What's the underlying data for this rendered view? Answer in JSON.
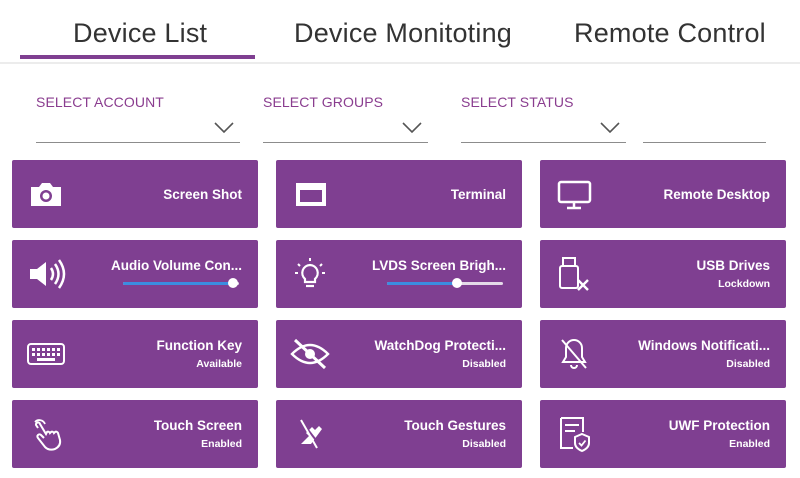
{
  "tabs": [
    {
      "label": "Device List",
      "active": true
    },
    {
      "label": "Device Monitoting",
      "active": false
    },
    {
      "label": "Remote Control",
      "active": false
    }
  ],
  "filters": {
    "account": {
      "label": "SELECT ACCOUNT",
      "value": ""
    },
    "groups": {
      "label": "SELECT GROUPS",
      "value": ""
    },
    "status": {
      "label": "SELECT STATUS",
      "value": ""
    },
    "search": {
      "value": ""
    }
  },
  "colors": {
    "accent": "#7f3f91",
    "label": "#8a3d8f",
    "slider_fill": "#3b8de0"
  },
  "tiles": [
    {
      "title": "Screen Shot",
      "subtitle": "",
      "icon": "camera-icon"
    },
    {
      "title": "Terminal",
      "subtitle": "",
      "icon": "terminal-window-icon"
    },
    {
      "title": "Remote Desktop",
      "subtitle": "",
      "icon": "monitor-icon"
    },
    {
      "title": "Audio Volume Con...",
      "subtitle": "",
      "icon": "speaker-icon",
      "level": 0.95
    },
    {
      "title": "LVDS Screen Brigh...",
      "subtitle": "",
      "icon": "lightbulb-icon",
      "level": 0.6
    },
    {
      "title": "USB Drives",
      "subtitle": "Lockdown",
      "icon": "usb-drive-blocked-icon"
    },
    {
      "title": "Function Key",
      "subtitle": "Available",
      "icon": "keyboard-icon"
    },
    {
      "title": "WatchDog Protecti...",
      "subtitle": "Disabled",
      "icon": "eye-slash-icon"
    },
    {
      "title": "Windows Notificati...",
      "subtitle": "Disabled",
      "icon": "bell-off-icon"
    },
    {
      "title": "Touch Screen",
      "subtitle": "Enabled",
      "icon": "touch-hand-icon"
    },
    {
      "title": "Touch Gestures",
      "subtitle": "Disabled",
      "icon": "gesture-off-icon"
    },
    {
      "title": "UWF Protection",
      "subtitle": "Enabled",
      "icon": "shield-document-icon"
    }
  ]
}
